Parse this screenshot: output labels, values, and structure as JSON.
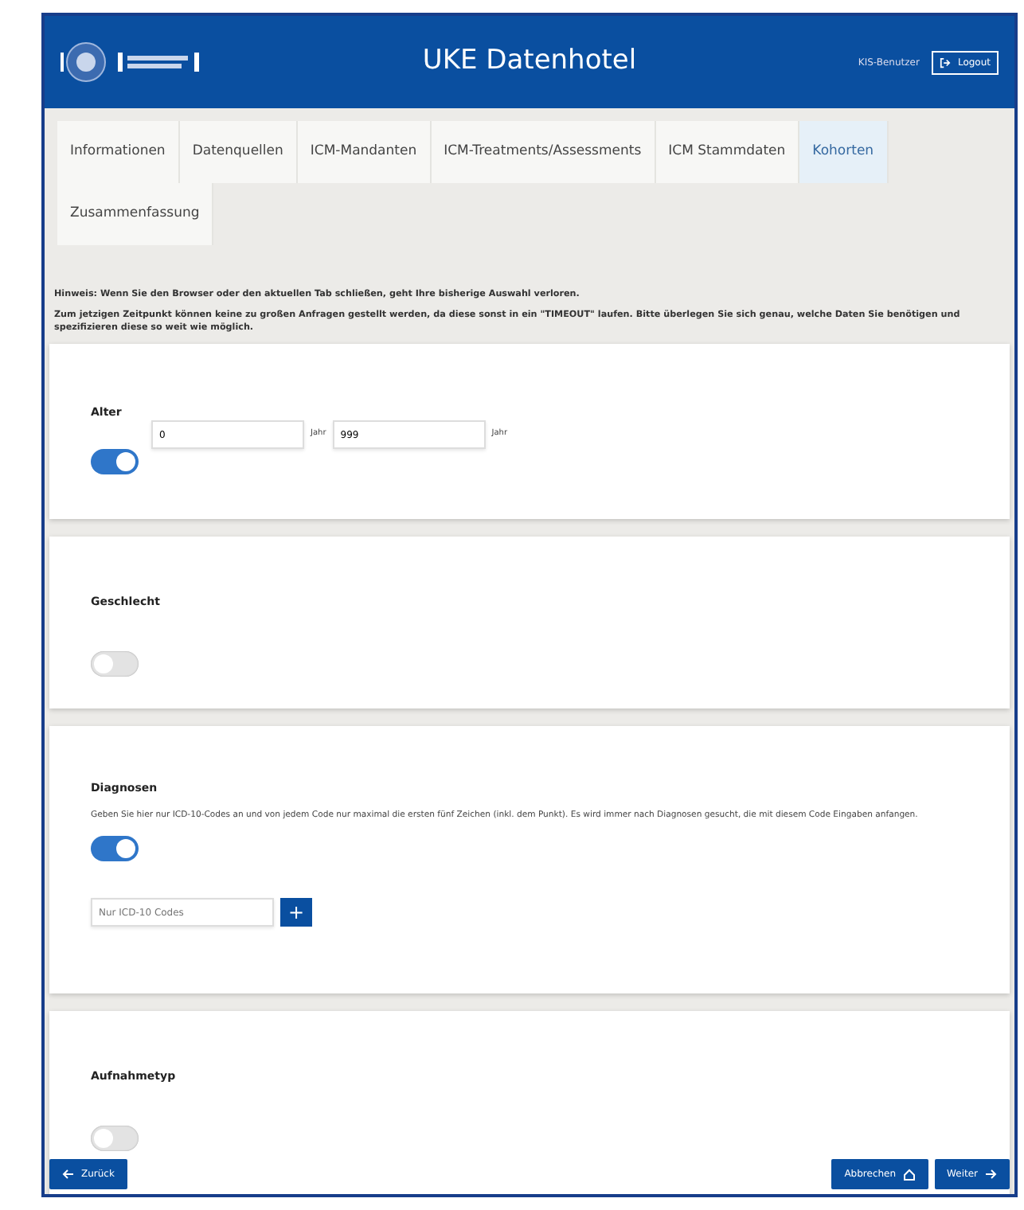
{
  "header": {
    "title": "UKE Datenhotel",
    "user": "KIS-Benutzer",
    "logout": "Logout"
  },
  "tabs": [
    {
      "label": "Informationen",
      "selected": false
    },
    {
      "label": "Datenquellen",
      "selected": false
    },
    {
      "label": "ICM-Mandanten",
      "selected": false
    },
    {
      "label": "ICM-Treatments/Assessments",
      "selected": false
    },
    {
      "label": "ICM Stammdaten",
      "selected": false
    },
    {
      "label": "Kohorten",
      "selected": true
    },
    {
      "label": "Zusammenfassung",
      "selected": false
    }
  ],
  "notes": [
    "Hinweis: Wenn Sie den Browser oder den aktuellen Tab schließen, geht Ihre bisherige Auswahl verloren.",
    "Zum jetzigen Zeitpunkt können keine zu großen Anfragen gestellt werden, da diese sonst in ein \"TIMEOUT\" laufen. Bitte überlegen Sie sich genau, welche Daten Sie benötigen und spezifizieren diese so weit wie möglich."
  ],
  "filters": [
    {
      "kind": "range",
      "title": "Alter",
      "on": true,
      "from": {
        "value": "0",
        "unit": "Jahr"
      },
      "to": {
        "value": "999",
        "unit": "Jahr"
      }
    },
    {
      "kind": "toggle",
      "title": "Geschlecht",
      "on": false
    },
    {
      "kind": "codes",
      "title": "Diagnosen",
      "description": "Geben Sie hier nur ICD-10-Codes an und von jedem Code nur maximal die ersten fünf Zeichen (inkl. dem Punkt). Es wird immer nach Diagnosen gesucht, die mit diesem Code Eingaben anfangen.",
      "on": true,
      "placeholder": "Nur ICD-10 Codes",
      "add": "+"
    },
    {
      "kind": "toggle",
      "title": "Aufnahmetyp",
      "on": false
    }
  ],
  "footer": {
    "back": "Zurück",
    "cancel": "Abbrechen",
    "next": "Weiter"
  }
}
